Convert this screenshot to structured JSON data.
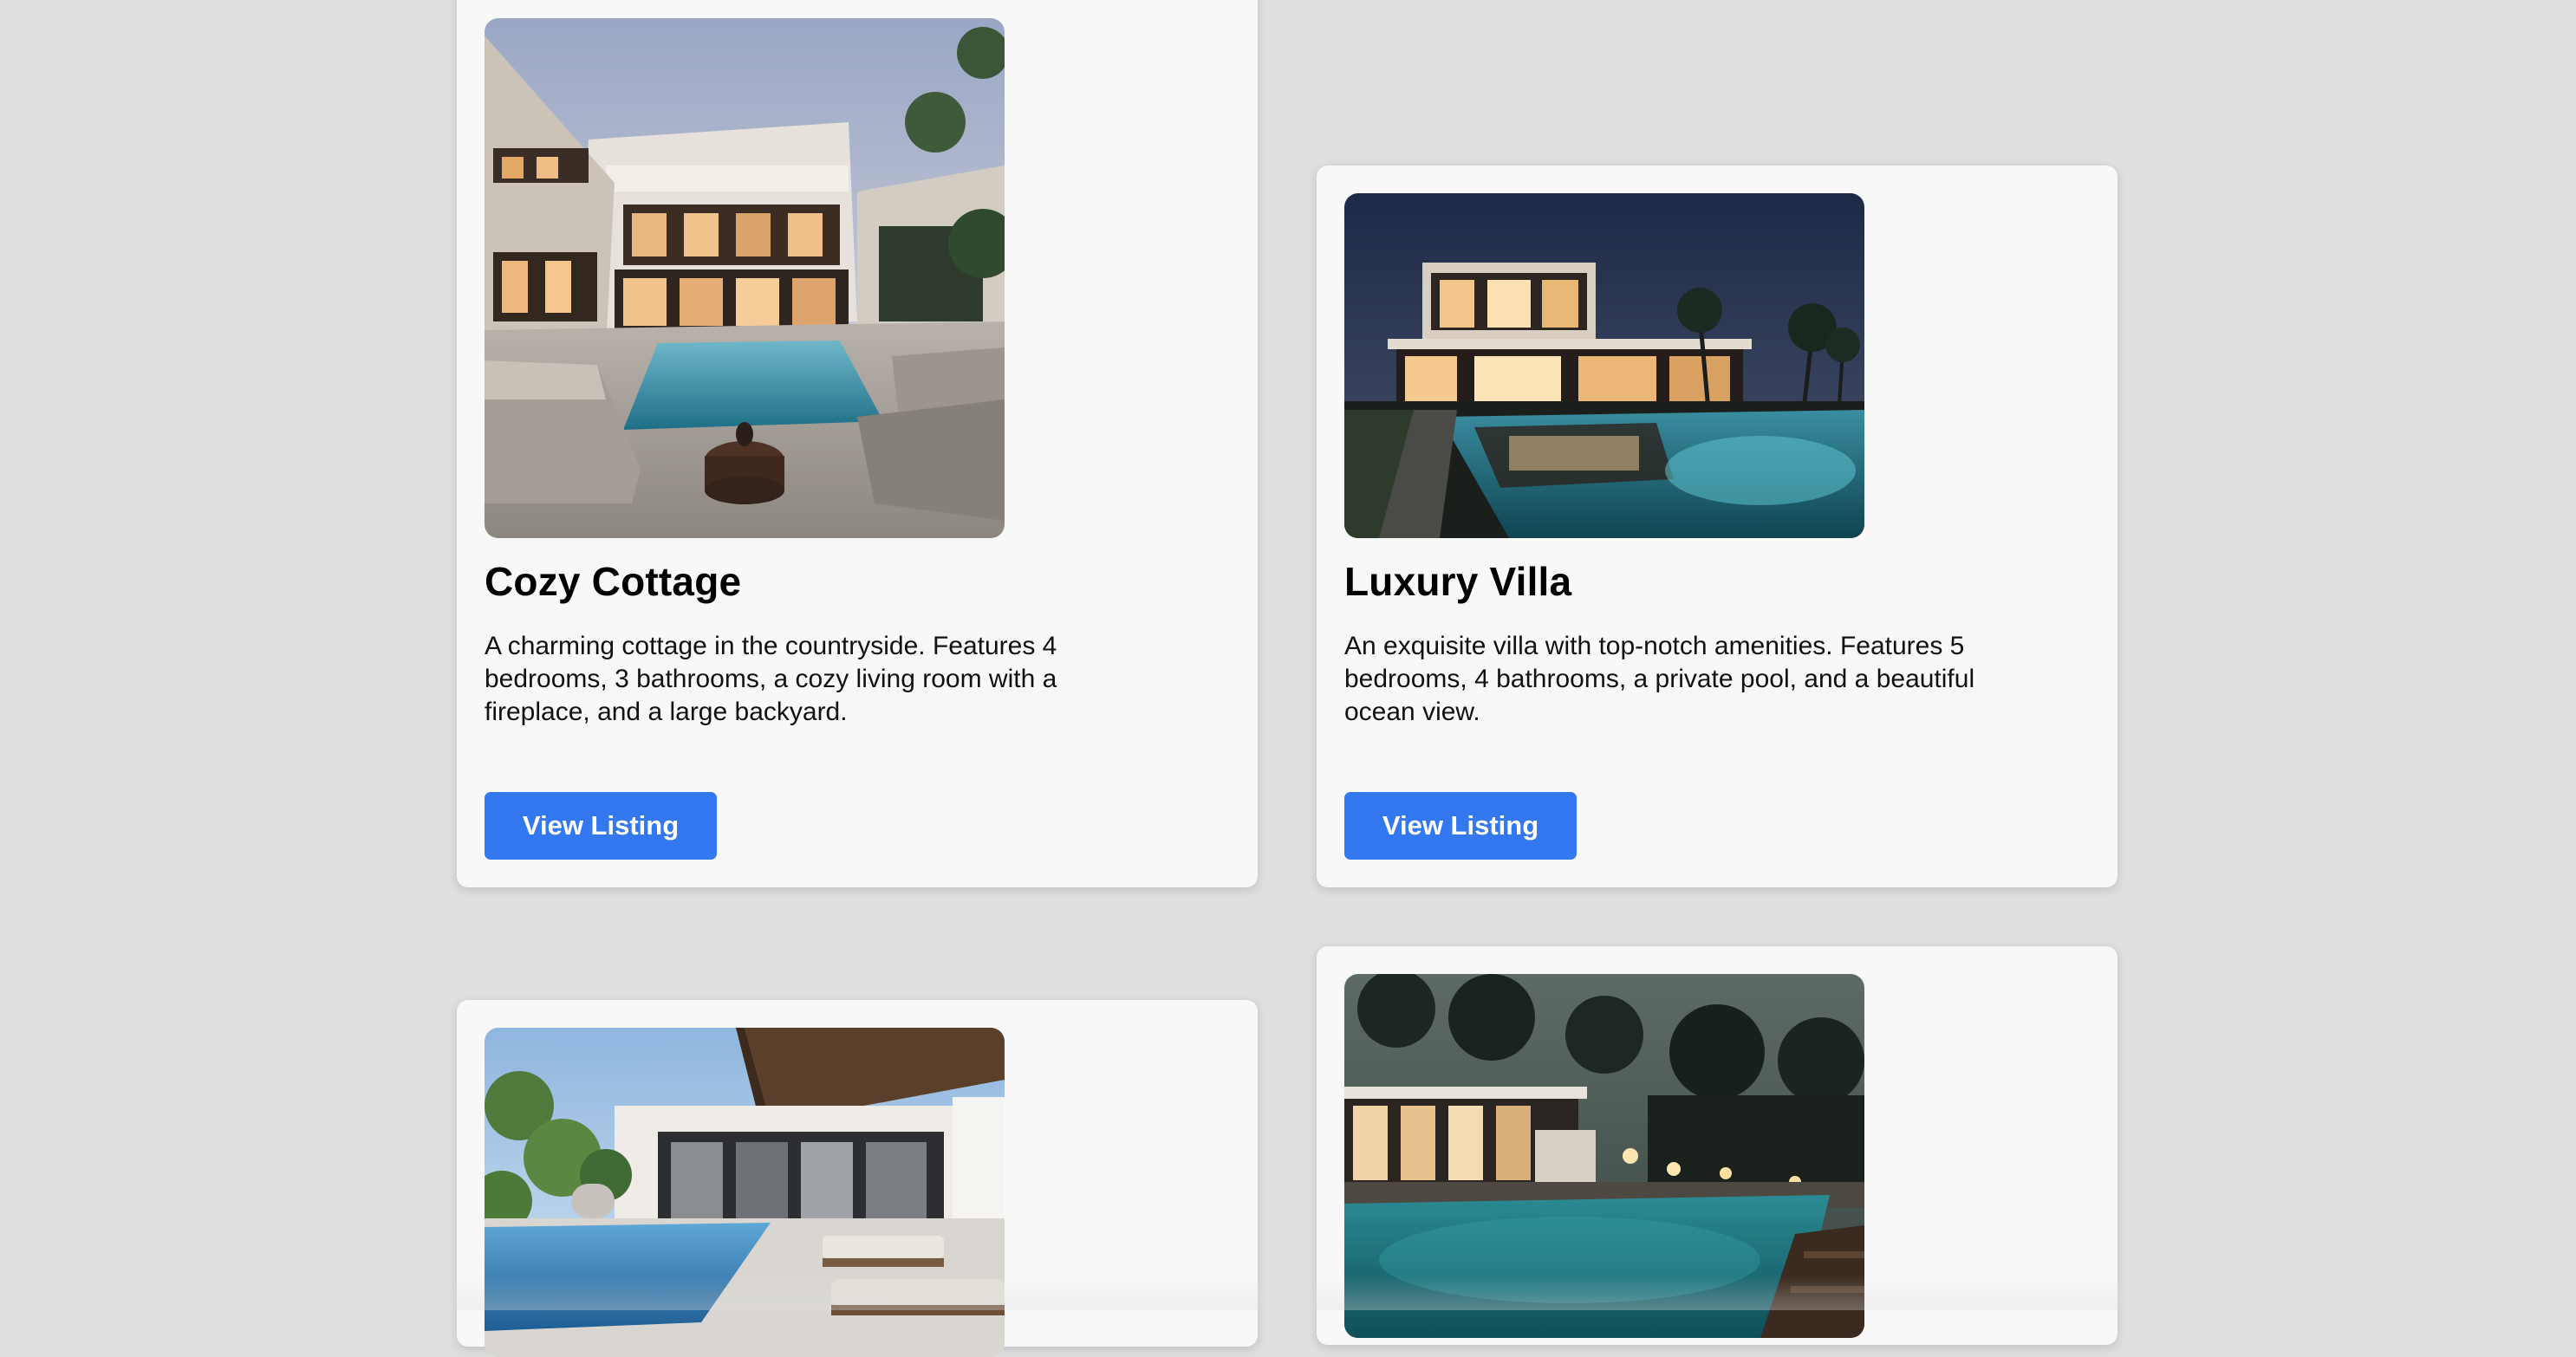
{
  "listings": [
    {
      "title": "Cozy Cottage",
      "description": "A charming cottage in the countryside. Features 4 bedrooms, 3 bathrooms, a cozy living room with a fireplace, and a large backyard.",
      "button_label": "View Listing"
    },
    {
      "title": "Luxury Villa",
      "description": "An exquisite villa with top-notch amenities. Features 5 bedrooms, 4 bathrooms, a private pool, and a beautiful ocean view.",
      "button_label": "View Listing"
    },
    {
      "title": "",
      "description": "",
      "button_label": ""
    },
    {
      "title": "",
      "description": "",
      "button_label": ""
    }
  ],
  "colors": {
    "page_background": "#dedede",
    "card_background": "#f8f8f8",
    "button_primary": "#3478f0",
    "button_text": "#ffffff"
  }
}
